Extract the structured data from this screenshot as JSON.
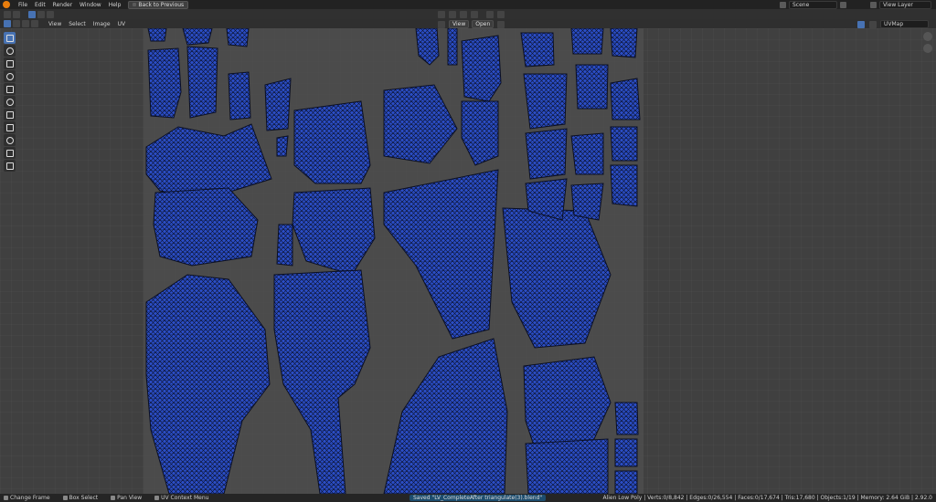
{
  "menubar": {
    "items": [
      "File",
      "Edit",
      "Render",
      "Window",
      "Help"
    ],
    "back_button": "Back to Previous",
    "scene_label": "Scene",
    "view_layer_label": "View Layer"
  },
  "editor_header": {
    "menus": [
      "View",
      "Select",
      "Image",
      "UV"
    ],
    "snap_view": "View",
    "snap_open": "Open",
    "uv_map": "UVMap"
  },
  "tools": [
    "cursor",
    "select-circle",
    "move",
    "rotate",
    "scale",
    "transform",
    "annotate",
    "rip",
    "grab",
    "relax",
    "pinch",
    "sculpt"
  ],
  "statusbar": {
    "left_items": [
      "Change Frame",
      "Box Select",
      "Pan View",
      "UV Context Menu"
    ],
    "saved_message": "Saved \"LV_CompleteAfter triangulate(3).blend\"",
    "stats": "Alien Low Poly | Verts:0/8,842 | Edges:0/26,554 | Faces:0/17,674 | Tris:17,680 | Objects:1/19 | Memory: 2.64 GiB | 2.92.0"
  },
  "colors": {
    "uv_fill": "#2b4ec8",
    "uv_edge": "#0a0f24",
    "image_bg": "#4a4a4a",
    "viewport_bg": "#404040",
    "accent": "#4772b3"
  }
}
